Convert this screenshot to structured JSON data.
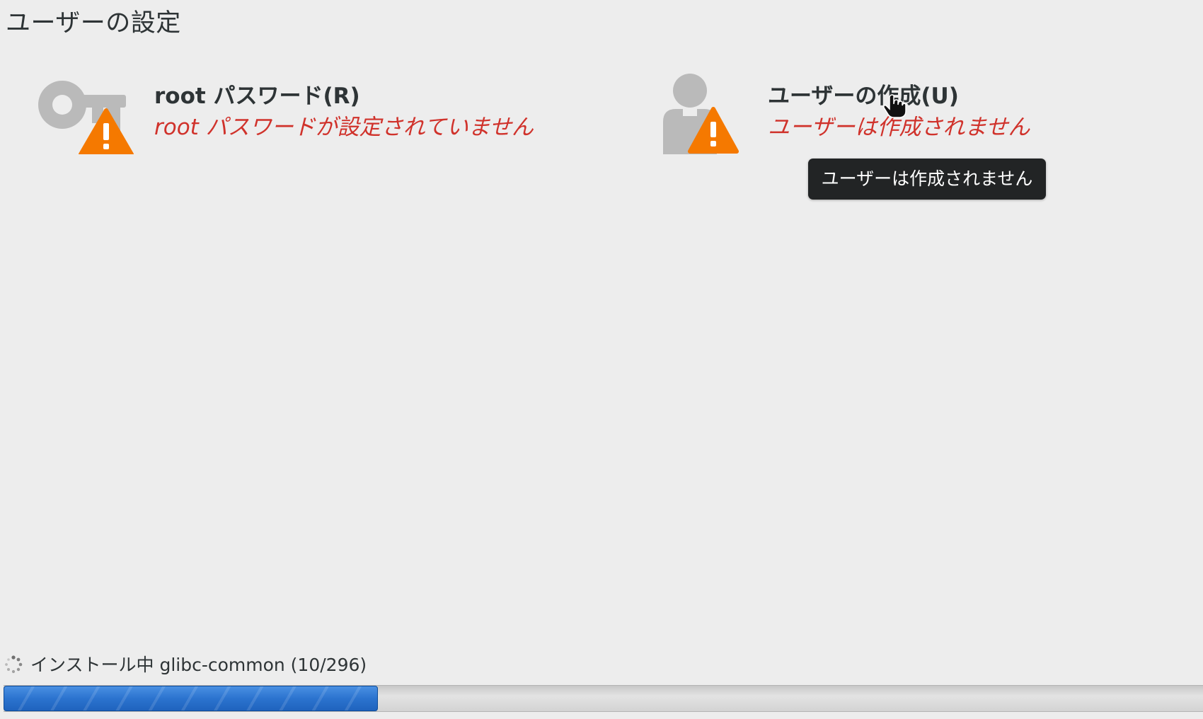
{
  "page": {
    "title": "ユーザーの設定"
  },
  "spokes": {
    "root_password": {
      "title": "root パスワード(R)",
      "status": "root パスワードが設定されていません",
      "icon": "key-warning-icon"
    },
    "user_creation": {
      "title": "ユーザーの作成(U)",
      "status": "ユーザーは作成されません",
      "icon": "user-warning-icon"
    }
  },
  "tooltip": {
    "text": "ユーザーは作成されません"
  },
  "progress": {
    "label": "インストール中 glibc-common (10/296)",
    "fraction": 0.312
  },
  "colors": {
    "background": "#ededed",
    "warning_text": "#d0322b",
    "warning_badge": "#f57900",
    "icon_gray": "#bababa",
    "progress_blue": "#2b73cf",
    "tooltip_bg": "#222425"
  }
}
